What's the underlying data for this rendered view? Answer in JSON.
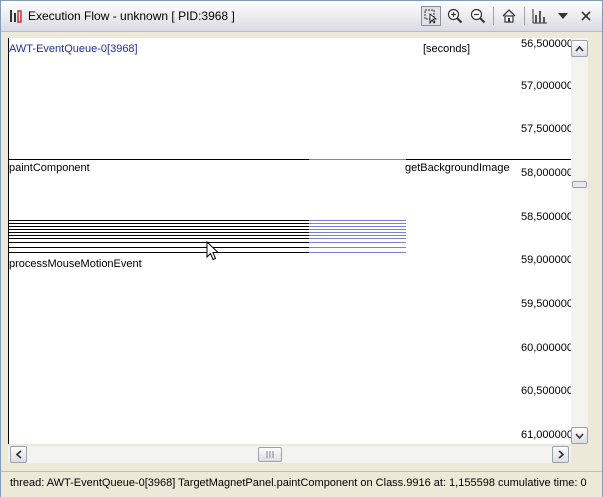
{
  "window": {
    "title": "Execution Flow - unknown [ PID:3968 ]"
  },
  "toolbar": {
    "buttons": [
      {
        "name": "select-tool",
        "icon": "cursor-select-icon"
      },
      {
        "name": "zoom-in",
        "icon": "zoom-in-icon"
      },
      {
        "name": "zoom-out",
        "icon": "zoom-out-icon"
      },
      {
        "name": "home",
        "icon": "home-icon"
      },
      {
        "name": "chart-options",
        "icon": "bar-chart-icon"
      },
      {
        "name": "menu",
        "icon": "chevron-down-icon"
      },
      {
        "name": "close",
        "icon": "close-icon"
      }
    ]
  },
  "flow": {
    "thread_name": "AWT-EventQueue-0[3968]",
    "units_label": "[seconds]",
    "time_ticks": [
      "56,500000",
      "57,000000",
      "57,500000",
      "58,000000",
      "58,500000",
      "59,000000",
      "59,500000",
      "60,000000",
      "60,500000",
      "61,000000"
    ],
    "methods": {
      "paint_component": "paintComponent",
      "get_background_image": "getBackgroundImage",
      "process_mouse_motion_event": "processMouseMotionEvent"
    }
  },
  "status": {
    "text": "thread: AWT-EventQueue-0[3968]   TargetMagnetPanel.paintComponent on Class.9916 at: 1,155598 cumulative time: 0"
  },
  "colors": {
    "thread_text": "#1f2f9f",
    "call_line": "#000000",
    "call_line_selected": "#7b83c8"
  }
}
